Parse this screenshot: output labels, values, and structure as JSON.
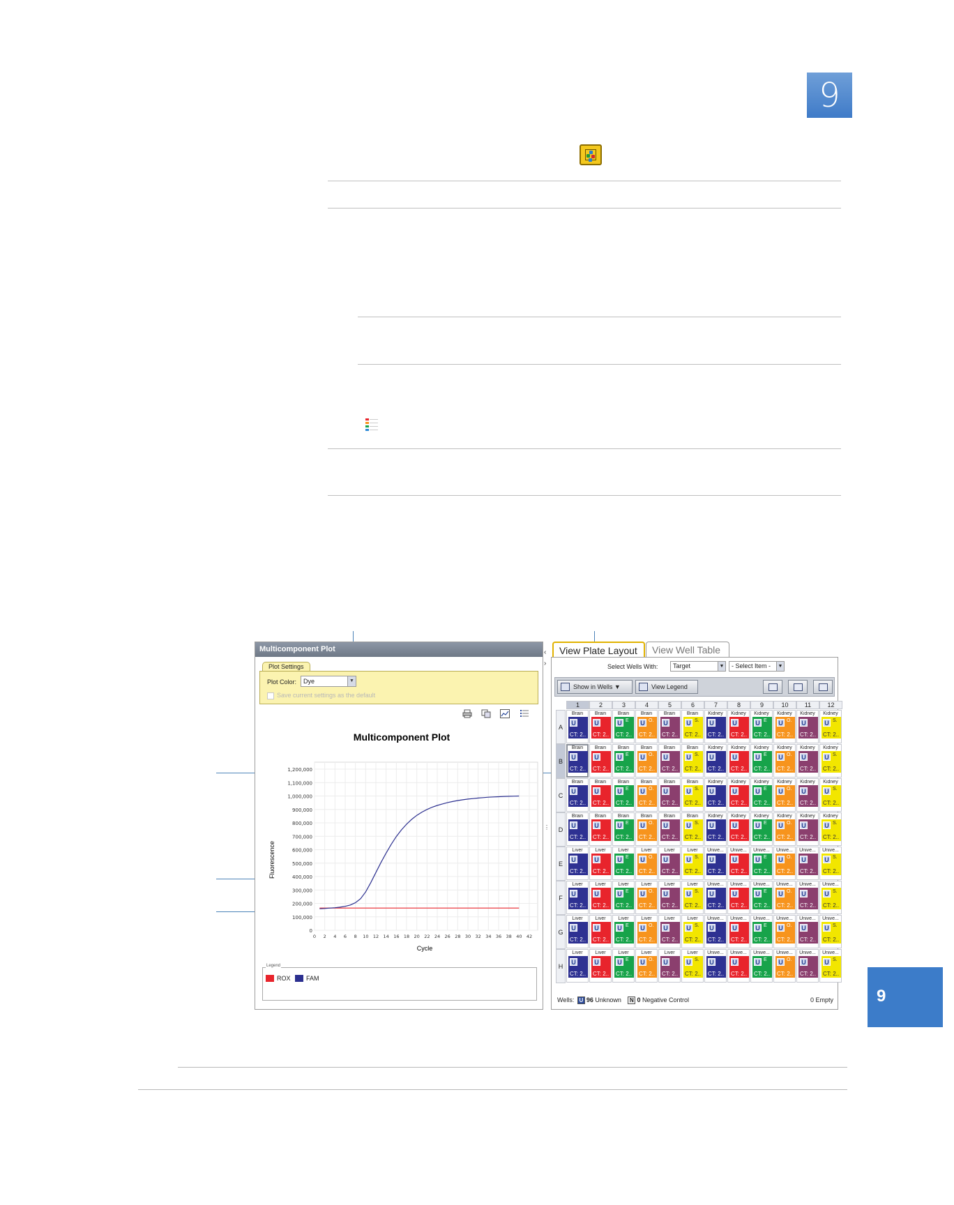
{
  "chapter_number": "9",
  "left_panel": {
    "title": "Multicomponent Plot",
    "plot_settings_tab": "Plot Settings",
    "plot_color_label": "Plot Color:",
    "plot_color_value": "Dye",
    "save_default_label": "Save current settings as the default",
    "tool_icons": [
      "print-icon",
      "copy-icon",
      "plot-chart-icon",
      "list-icon"
    ],
    "legend_caption": "Legend",
    "legend": [
      {
        "name": "ROX",
        "color": "#e8242c"
      },
      {
        "name": "FAM",
        "color": "#2b2f8f"
      }
    ]
  },
  "chart_data": {
    "type": "line",
    "title": "Multicomponent Plot",
    "xlabel": "Cycle",
    "ylabel": "Fluorescence",
    "xlim": [
      0,
      42
    ],
    "ylim": [
      0,
      1200000
    ],
    "x_ticks": [
      "0",
      "2",
      "4",
      "6",
      "8",
      "10",
      "12",
      "14",
      "16",
      "18",
      "20",
      "22",
      "24",
      "26",
      "28",
      "30",
      "32",
      "34",
      "36",
      "38",
      "40",
      "42"
    ],
    "y_ticks": [
      "0",
      "100,000",
      "200,000",
      "300,000",
      "400,000",
      "500,000",
      "600,000",
      "700,000",
      "800,000",
      "900,000",
      "1,000,000",
      "1,100,000",
      "1,200,000"
    ],
    "grid": true,
    "series": [
      {
        "name": "ROX",
        "color": "#e8242c",
        "x": [
          1,
          10,
          20,
          30,
          40
        ],
        "y": [
          165000,
          165000,
          165000,
          165000,
          165000
        ]
      },
      {
        "name": "FAM",
        "color": "#2b2f8f",
        "x": [
          1,
          2,
          3,
          4,
          5,
          6,
          7,
          8,
          9,
          10,
          11,
          12,
          13,
          14,
          15,
          16,
          17,
          18,
          19,
          20,
          21,
          22,
          23,
          24,
          25,
          26,
          27,
          28,
          29,
          30,
          31,
          32,
          33,
          34,
          35,
          36,
          37,
          38,
          39,
          40
        ],
        "y": [
          160000,
          162000,
          165000,
          168000,
          172000,
          178000,
          188000,
          205000,
          235000,
          285000,
          355000,
          430000,
          505000,
          575000,
          640000,
          698000,
          748000,
          790000,
          826000,
          856000,
          880000,
          900000,
          917000,
          930000,
          941000,
          951000,
          959000,
          966000,
          972000,
          977000,
          981000,
          985000,
          988000,
          991000,
          993000,
          995000,
          997000,
          998000,
          999000,
          1000000
        ]
      }
    ]
  },
  "right_panel": {
    "tabs": [
      "View Plate Layout",
      "View Well Table"
    ],
    "select_wells_label": "Select Wells With:",
    "select_wells_value": "Target",
    "select_item_value": "- Select Item -",
    "show_in_wells": "Show in Wells ▼",
    "view_legend": "View Legend",
    "columns": [
      "1",
      "2",
      "3",
      "4",
      "5",
      "6",
      "7",
      "8",
      "9",
      "10",
      "11",
      "12"
    ],
    "rows": [
      "A",
      "B",
      "C",
      "D",
      "E",
      "F",
      "G",
      "H"
    ],
    "row_names": [
      [
        "Brain",
        "Brain",
        "Brain",
        "Brain",
        "Brain",
        "Brain",
        "Kidney",
        "Kidney",
        "Kidney",
        "Kidney",
        "Kidney",
        "Kidney"
      ],
      [
        "Brain",
        "Brain",
        "Brain",
        "Brain",
        "Brain",
        "Brain",
        "Kidney",
        "Kidney",
        "Kidney",
        "Kidney",
        "Kidney",
        "Kidney"
      ],
      [
        "Brain",
        "Brain",
        "Brain",
        "Brain",
        "Brain",
        "Brain",
        "Kidney",
        "Kidney",
        "Kidney",
        "Kidney",
        "Kidney",
        "Kidney"
      ],
      [
        "Brain",
        "Brain",
        "Brain",
        "Brain",
        "Brain",
        "Brain",
        "Kidney",
        "Kidney",
        "Kidney",
        "Kidney",
        "Kidney",
        "Kidney"
      ],
      [
        "Liver",
        "Liver",
        "Liver",
        "Liver",
        "Liver",
        "Liver",
        "Unive...",
        "Unive...",
        "Unive...",
        "Unive...",
        "Unive...",
        "Unive..."
      ],
      [
        "Liver",
        "Liver",
        "Liver",
        "Liver",
        "Liver",
        "Liver",
        "Unive...",
        "Unive...",
        "Unive...",
        "Unive...",
        "Unive...",
        "Unive..."
      ],
      [
        "Liver",
        "Liver",
        "Liver",
        "Liver",
        "Liver",
        "Liver",
        "Unive...",
        "Unive...",
        "Unive...",
        "Unive...",
        "Unive...",
        "Unive..."
      ],
      [
        "Liver",
        "Liver",
        "Liver",
        "Liver",
        "Liver",
        "Liver",
        "Unive...",
        "Unive...",
        "Unive...",
        "Unive...",
        "Unive...",
        "Unive..."
      ]
    ],
    "col_colors": [
      "#2e3192",
      "#e8242c",
      "#17a34a",
      "#f7941d",
      "#8b3f6e",
      "#f2e600",
      "#2e3192",
      "#e8242c",
      "#17a34a",
      "#f7941d",
      "#8b3f6e",
      "#f2e600"
    ],
    "col_sup": [
      "",
      "",
      "E",
      "O.",
      "",
      "S.",
      "",
      "",
      "E",
      "O.",
      "",
      "S."
    ],
    "ct_label": "CT: 2..",
    "well_symbol": "U",
    "footer_wells_label": "Wells:",
    "footer_unknown_count": "96",
    "footer_unknown_label": "Unknown",
    "footer_neg_symbol": "N",
    "footer_neg_count": "0",
    "footer_neg_label": "Negative Control",
    "footer_empty": "0 Empty"
  }
}
